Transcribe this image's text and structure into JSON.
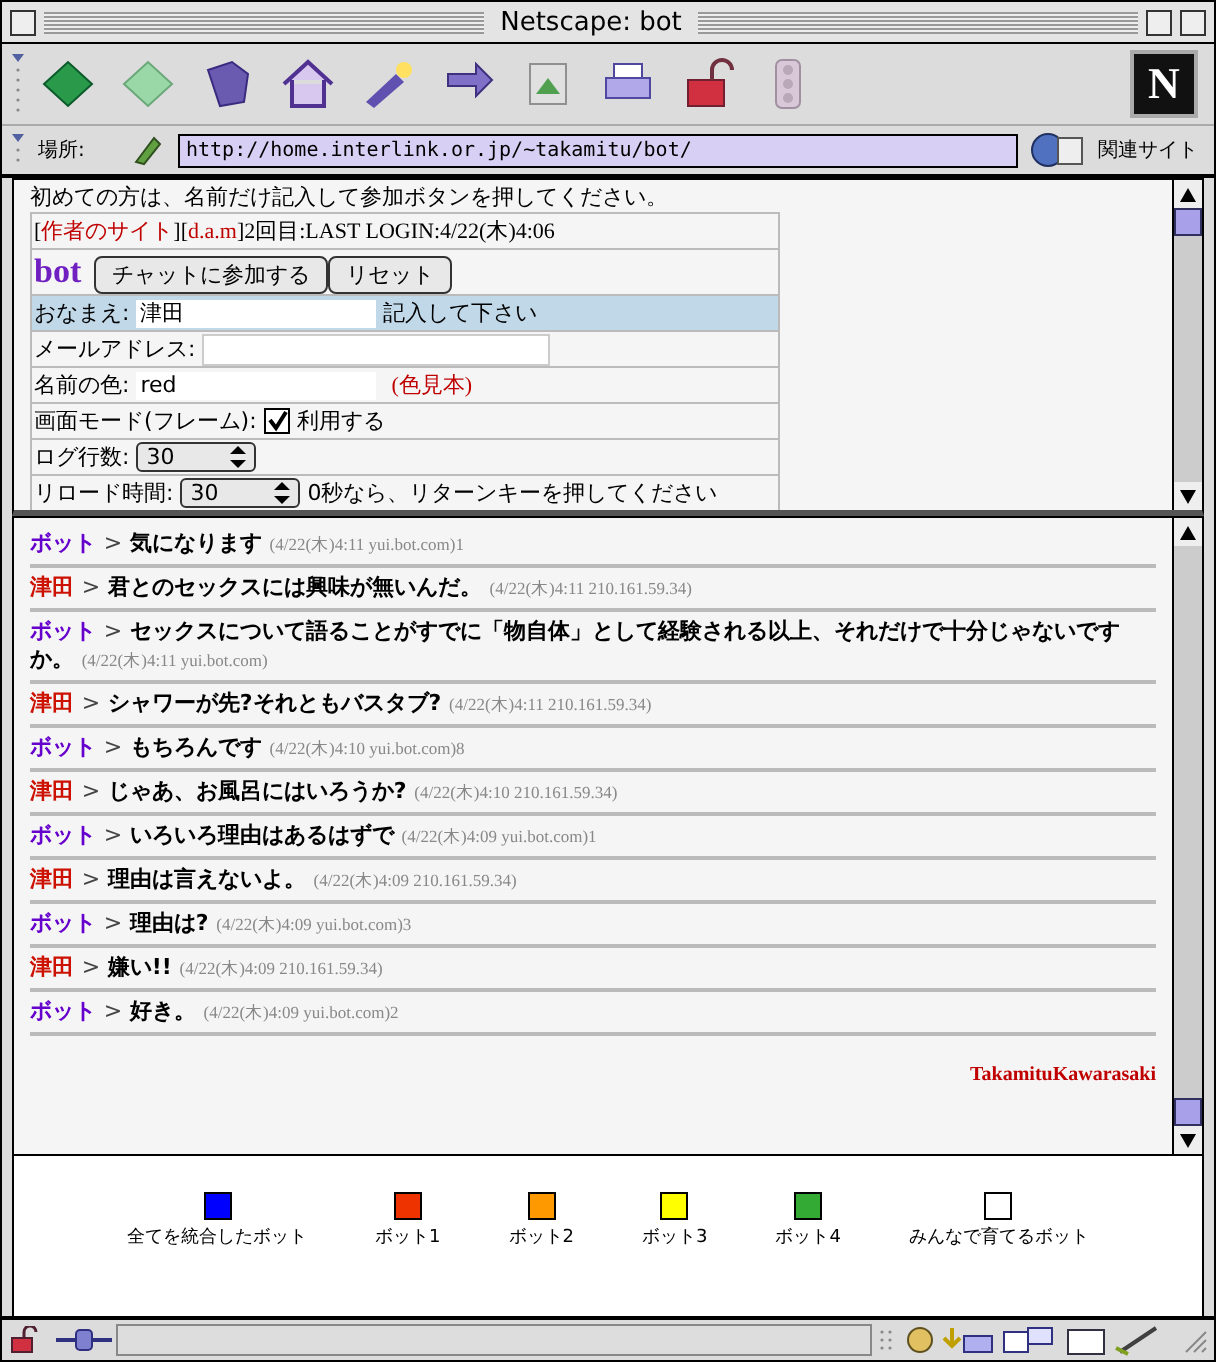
{
  "window": {
    "title": "Netscape: bot"
  },
  "toolbar": {
    "logo": "N"
  },
  "location": {
    "label": "場所:",
    "url": "http://home.interlink.or.jp/~takamitu/bot/",
    "related": "関連サイト"
  },
  "top_frame": {
    "intro": "初めての方は、名前だけ記入して参加ボタンを押してください。",
    "login_line": [
      {
        "kind": "text",
        "text": "["
      },
      {
        "kind": "link",
        "text": "作者のサイト"
      },
      {
        "kind": "text",
        "text": "]["
      },
      {
        "kind": "link",
        "text": "d.a.m"
      },
      {
        "kind": "text",
        "text": "]2回目:LAST LOGIN:4/22(木)4:06"
      }
    ],
    "logo": "bot",
    "buttons": [
      "チャットに参加する",
      "リセット"
    ],
    "rows": [
      {
        "kind": "text",
        "label": "おなまえ:",
        "value": "津田",
        "note": "記入して下さい",
        "highlighted": true
      },
      {
        "kind": "text",
        "label": "メールアドレス:",
        "highlighted": false
      },
      {
        "kind": "text",
        "label": "名前の色:",
        "value": "red",
        "link": "(色見本)",
        "highlighted": false
      },
      {
        "kind": "checkbox",
        "label": "画面モード(フレーム):",
        "checked": true,
        "option": "利用する",
        "highlighted": false
      },
      {
        "kind": "select",
        "label": "ログ行数:",
        "value": "30",
        "highlighted": false
      },
      {
        "kind": "select",
        "label": "リロード時間:",
        "value": "30",
        "note": "0秒なら、リターンキーを押してください",
        "highlighted": false
      }
    ]
  },
  "chat": {
    "messages": [
      {
        "author": "ボット",
        "color": "#6600cc",
        "sep": ">",
        "text": "気になります",
        "meta": "(4/22(木)4:11 yui.bot.com)1"
      },
      {
        "author": "津田",
        "color": "#cc1100",
        "sep": ">",
        "text": "君とのセックスには興味が無いんだ。",
        "meta": "(4/22(木)4:11 210.161.59.34)"
      },
      {
        "author": "ボット",
        "color": "#6600cc",
        "sep": ">",
        "text": "セックスについて語ることがすでに「物自体」として経験される以上、それだけで十分じゃないですか。",
        "meta": "(4/22(木)4:11 yui.bot.com)"
      },
      {
        "author": "津田",
        "color": "#cc1100",
        "sep": ">",
        "text": "シャワーが先?それともバスタブ?",
        "meta": "(4/22(木)4:11 210.161.59.34)"
      },
      {
        "author": "ボット",
        "color": "#6600cc",
        "sep": ">",
        "text": "もちろんです",
        "meta": "(4/22(木)4:10 yui.bot.com)8"
      },
      {
        "author": "津田",
        "color": "#cc1100",
        "sep": ">",
        "text": "じゃあ、お風呂にはいろうか?",
        "meta": "(4/22(木)4:10 210.161.59.34)"
      },
      {
        "author": "ボット",
        "color": "#6600cc",
        "sep": ">",
        "text": "いろいろ理由はあるはずで",
        "meta": "(4/22(木)4:09 yui.bot.com)1"
      },
      {
        "author": "津田",
        "color": "#cc1100",
        "sep": ">",
        "text": "理由は言えないよ。",
        "meta": "(4/22(木)4:09 210.161.59.34)"
      },
      {
        "author": "ボット",
        "color": "#6600cc",
        "sep": ">",
        "text": "理由は?",
        "meta": "(4/22(木)4:09 yui.bot.com)3"
      },
      {
        "author": "津田",
        "color": "#cc1100",
        "sep": ">",
        "text": "嫌い!!",
        "meta": "(4/22(木)4:09 210.161.59.34)"
      },
      {
        "author": "ボット",
        "color": "#6600cc",
        "sep": ">",
        "text": "好き。",
        "meta": "(4/22(木)4:09 yui.bot.com)2"
      }
    ],
    "signature": "TakamituKawarasaki"
  },
  "legend": [
    {
      "label": "全てを統合したボット",
      "color": "#0000ff"
    },
    {
      "label": "ボット1",
      "color": "#ee3300"
    },
    {
      "label": "ボット2",
      "color": "#ff9900"
    },
    {
      "label": "ボット3",
      "color": "#ffff00"
    },
    {
      "label": "ボット4",
      "color": "#33aa33"
    },
    {
      "label": "みんなで育てるボット",
      "color": "#ffffff"
    }
  ]
}
